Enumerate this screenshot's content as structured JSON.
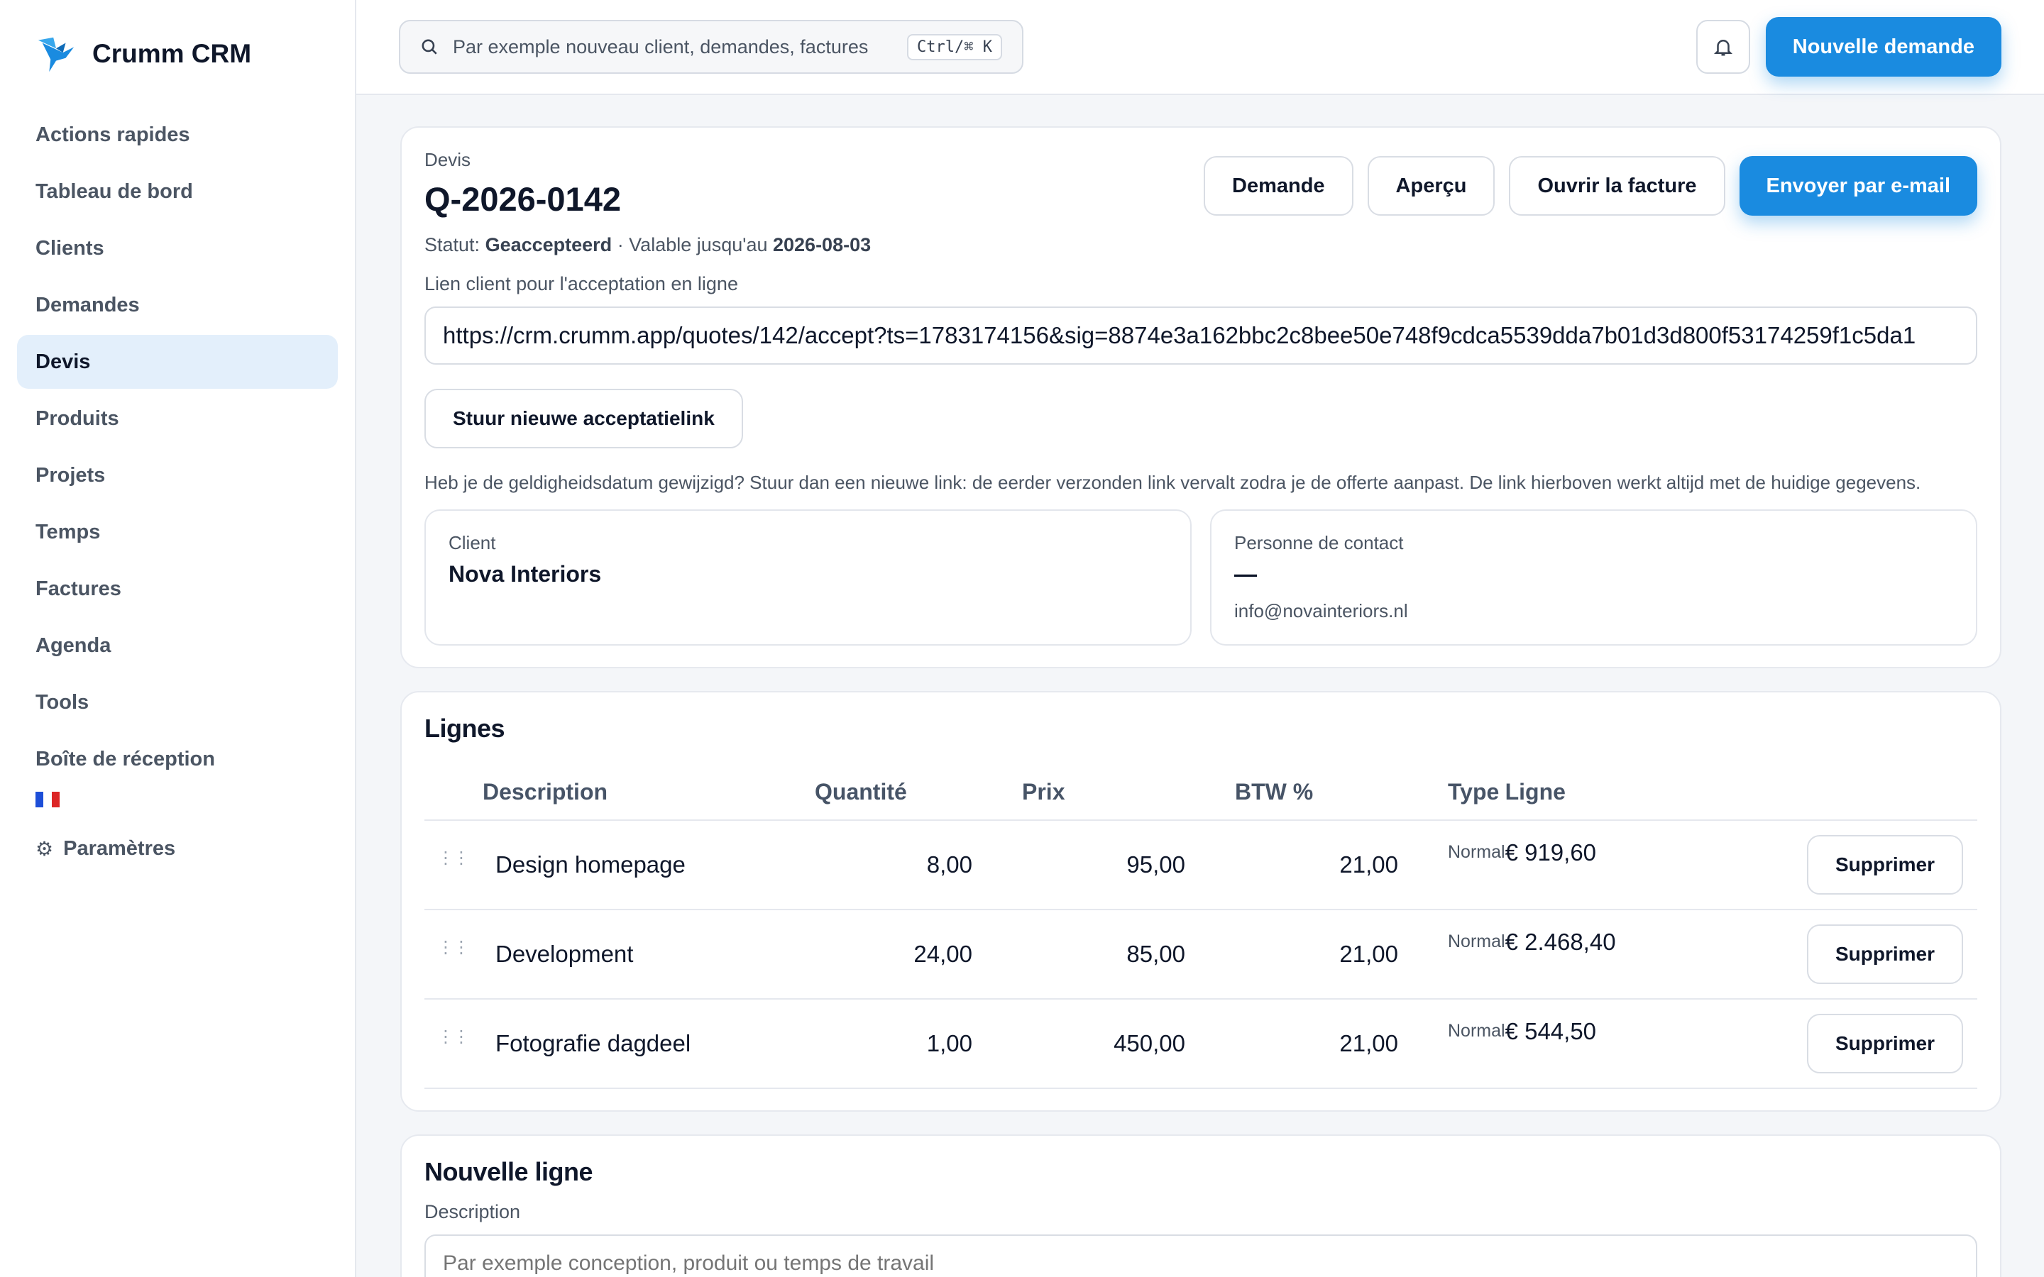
{
  "brand": {
    "name": "Crumm CRM"
  },
  "sidebar": {
    "items": [
      {
        "label": "Actions rapides"
      },
      {
        "label": "Tableau de bord"
      },
      {
        "label": "Clients"
      },
      {
        "label": "Demandes"
      },
      {
        "label": "Devis",
        "active": true
      },
      {
        "label": "Produits"
      },
      {
        "label": "Projets"
      },
      {
        "label": "Temps"
      },
      {
        "label": "Factures"
      },
      {
        "label": "Agenda"
      },
      {
        "label": "Tools"
      },
      {
        "label": "Boîte de réception"
      }
    ],
    "language_flag": "fr-flag-icon",
    "settings_label": "Paramètres"
  },
  "topbar": {
    "search_placeholder": "Par exemple nouveau client, demandes, factures",
    "shortcut": "Ctrl/⌘ K",
    "new_request_label": "Nouvelle demande"
  },
  "quote": {
    "type_label": "Devis",
    "number": "Q-2026-0142",
    "status_prefix": "Statut:",
    "status": "Geaccepteerd",
    "valid_prefix": "· Valable jusqu'au",
    "valid_until": "2026-08-03",
    "actions": {
      "request": "Demande",
      "preview": "Aperçu",
      "open_invoice": "Ouvrir la facture",
      "send_email": "Envoyer par e-mail"
    },
    "link_label": "Lien client pour l'acceptation en ligne",
    "link_value": "https://crm.crumm.app/quotes/142/accept?ts=1783174156&sig=8874e3a162bbc2c8bee50e748f9cdca5539dda7b01d3d800f53174259f1c5da1",
    "resend_label": "Stuur nieuwe acceptatielink",
    "hint": "Heb je de geldigheidsdatum gewijzigd? Stuur dan een nieuwe link: de eerder verzonden link vervalt zodra je de offerte aanpast. De link hierboven werkt altijd met de huidige gegevens.",
    "client_label": "Client",
    "client_name": "Nova Interiors",
    "contact_label": "Personne de contact",
    "contact_name": "—",
    "contact_email": "info@novainteriors.nl"
  },
  "lines": {
    "title": "Lignes",
    "columns": {
      "description": "Description",
      "quantity": "Quantité",
      "price": "Prix",
      "vat": "BTW %",
      "type": "Type",
      "line": "Ligne"
    },
    "rows": [
      {
        "description": "Design homepage",
        "quantity": "8,00",
        "price": "95,00",
        "vat": "21,00",
        "type": "Normal",
        "total": "€ 919,60",
        "delete": "Supprimer"
      },
      {
        "description": "Development",
        "quantity": "24,00",
        "price": "85,00",
        "vat": "21,00",
        "type": "Normal",
        "total": "€ 2.468,40",
        "delete": "Supprimer"
      },
      {
        "description": "Fotografie dagdeel",
        "quantity": "1,00",
        "price": "450,00",
        "vat": "21,00",
        "type": "Normal",
        "total": "€ 544,50",
        "delete": "Supprimer"
      }
    ]
  },
  "new_line": {
    "title": "Nouvelle ligne",
    "description_label": "Description",
    "description_placeholder": "Par exemple conception, produit ou temps de travail"
  },
  "colors": {
    "accent": "#1a8be0",
    "active_nav_bg": "#e3effb"
  }
}
